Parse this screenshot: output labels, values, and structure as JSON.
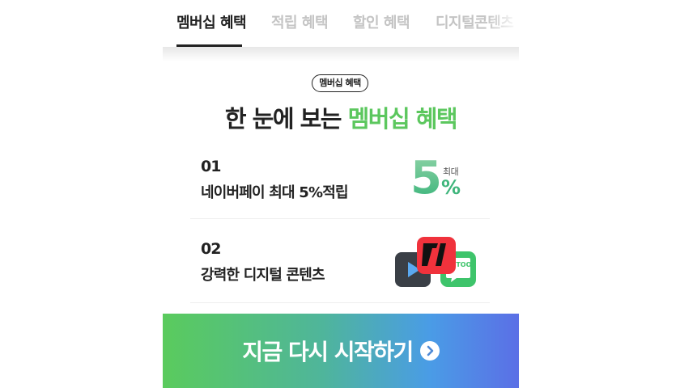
{
  "tabs": [
    {
      "label": "멤버십 혜택",
      "active": true
    },
    {
      "label": "적립 혜택",
      "active": false
    },
    {
      "label": "할인 혜택",
      "active": false
    },
    {
      "label": "디지털콘텐츠",
      "active": false
    }
  ],
  "section": {
    "badge": "멤버십 혜택",
    "headline_prefix": "한 눈에 보는 ",
    "headline_highlight": "멤버십 혜택",
    "accent_color": "#5cc75e"
  },
  "benefits": [
    {
      "number": "01",
      "title": "네이버페이 최대 5%적립",
      "graphic": {
        "max_label": "최대",
        "value": "5",
        "unit": "%"
      }
    },
    {
      "number": "02",
      "title": "강력한 디지털 콘텐츠",
      "icons": [
        "series-play-icon",
        "vlive-icon",
        "webtoon-icon"
      ]
    }
  ],
  "webtoon_icon_text": "WEBTOON",
  "cta": {
    "label": "지금 다시 시작하기",
    "icon": "chevron-right-circle-icon"
  }
}
